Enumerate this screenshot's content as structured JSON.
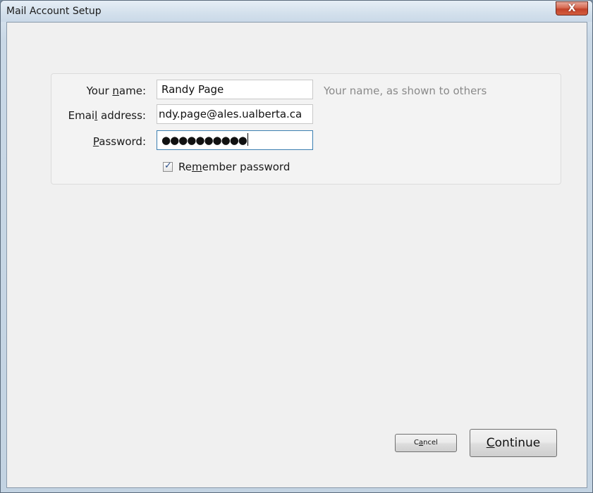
{
  "window": {
    "title": "Mail Account Setup",
    "close_glyph": "X"
  },
  "form": {
    "name": {
      "label_pre": "Your ",
      "label_accel": "n",
      "label_post": "ame:",
      "value": "Randy Page",
      "hint": "Your name, as shown to others"
    },
    "email": {
      "label_pre": "Emai",
      "label_accel": "l",
      "label_post": " address:",
      "value": "ndy.page@ales.ualberta.ca"
    },
    "password": {
      "label_pre": "",
      "label_accel": "P",
      "label_post": "assword:",
      "value": "●●●●●●●●●●"
    },
    "remember": {
      "label_pre": "Re",
      "label_accel": "m",
      "label_post": "ember password",
      "checked": true,
      "check_glyph": "✓"
    }
  },
  "buttons": {
    "cancel": {
      "pre": "C",
      "accel": "a",
      "post": "ncel"
    },
    "continue": {
      "pre": "",
      "accel": "C",
      "post": "ontinue"
    }
  }
}
